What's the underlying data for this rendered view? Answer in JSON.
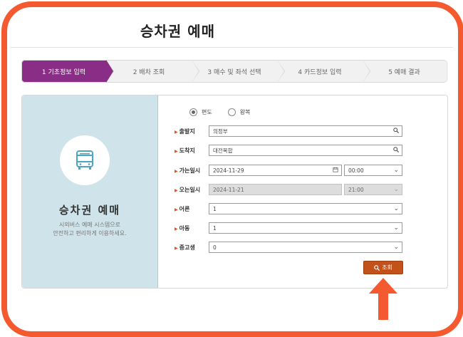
{
  "page": {
    "title": "승차권 예매"
  },
  "steps": [
    {
      "label": "1 기초정보 입력"
    },
    {
      "label": "2 배차 조회"
    },
    {
      "label": "3 매수 및 좌석 선택"
    },
    {
      "label": "4 카드정보 입력"
    },
    {
      "label": "5 예매 결과"
    }
  ],
  "intro": {
    "icon": "bus-icon",
    "title": "승차권 예매",
    "desc_line1": "시외버스 예매 시스템으로",
    "desc_line2": "안전하고 편리하게 이용하세요."
  },
  "trip_type": {
    "one_way": "편도",
    "round_trip": "왕복",
    "selected": "편도"
  },
  "form": {
    "departure": {
      "label": "출발지",
      "value": "의정부"
    },
    "arrival": {
      "label": "도착지",
      "value": "대전복합"
    },
    "go_date": {
      "label": "가는일시",
      "date": "2024-11-29",
      "time": "00:00"
    },
    "return_date": {
      "label": "오는일시",
      "date": "2024-11-21",
      "time": "21:00"
    },
    "adult": {
      "label": "어른",
      "value": "1"
    },
    "child": {
      "label": "아동",
      "value": "1"
    },
    "student": {
      "label": "중고생",
      "value": "0"
    }
  },
  "actions": {
    "search": "조회"
  },
  "colors": {
    "accent": "#f4592f",
    "step_active": "#8a2d86",
    "button": "#c2511a",
    "side_panel": "#cfe3ea"
  }
}
